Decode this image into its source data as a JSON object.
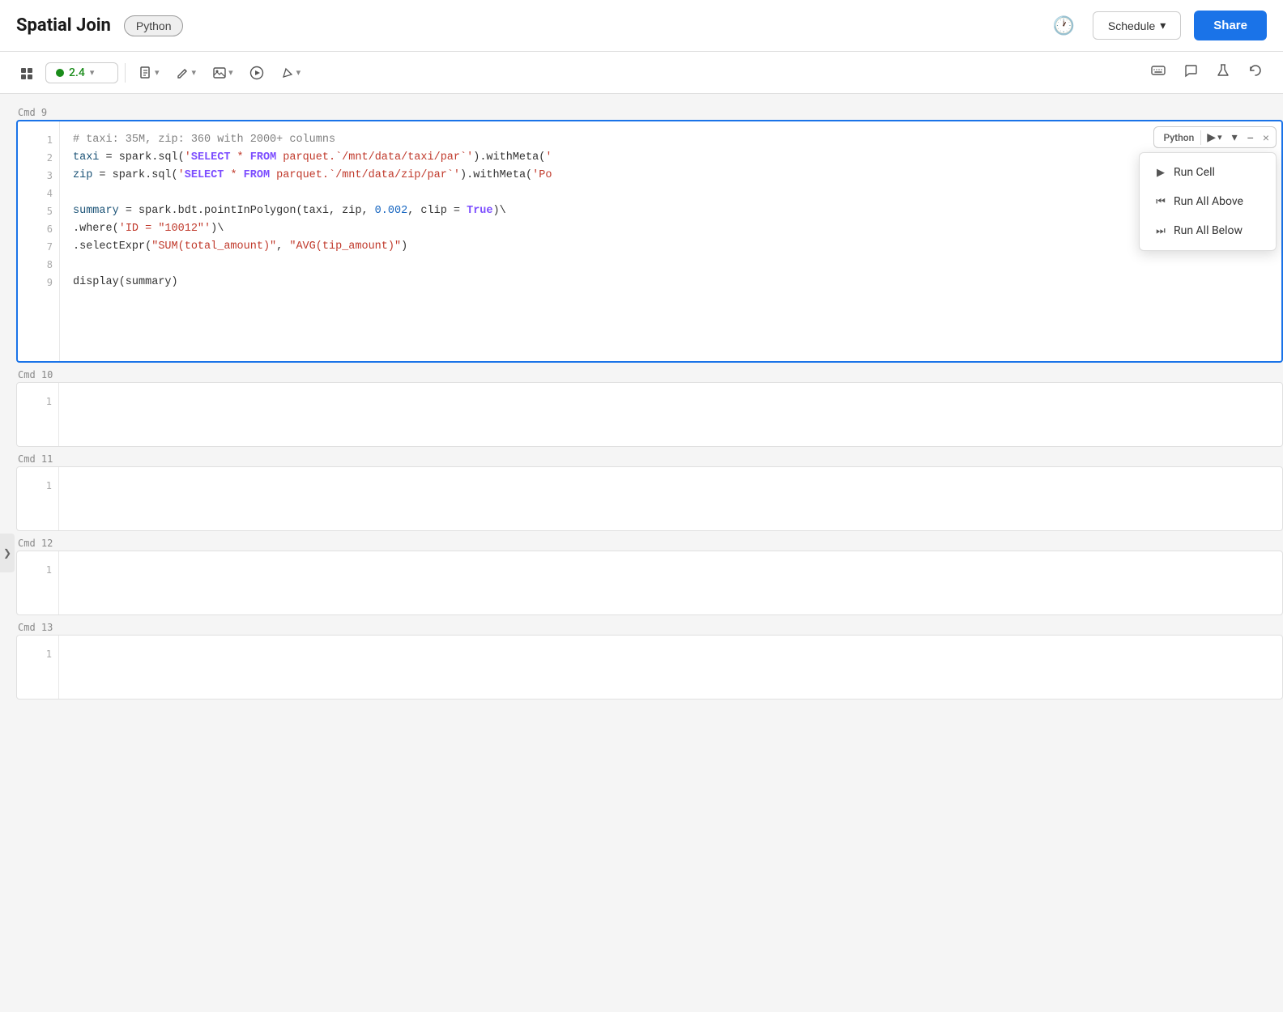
{
  "navbar": {
    "title": "Spatial Join",
    "lang_badge": "Python",
    "history_icon": "🕐",
    "schedule_label": "Schedule",
    "schedule_chevron": "▾",
    "share_label": "Share"
  },
  "toolbar": {
    "cluster_icon": "⊞",
    "status_value": "2.4",
    "status_color": "#1a8c1a",
    "doc_btn": "📄",
    "edit_btn": "✏️",
    "image_btn": "🖼",
    "run_btn": "▶",
    "pen_btn": "✒️",
    "keyboard_icon": "⌨",
    "comment_icon": "💬",
    "flask_icon": "⚗",
    "history_icon": "↺"
  },
  "active_cell": {
    "label": "Cmd 9",
    "lang": "Python",
    "run_label": "▶",
    "chevron_down": "▾",
    "collapse": "▾",
    "minus": "−",
    "close": "×",
    "lines": [
      {
        "num": 1,
        "parts": [
          {
            "type": "comment",
            "text": "# taxi: 35M, zip: 360 with 2000+ columns"
          }
        ]
      },
      {
        "num": 2,
        "parts": [
          {
            "type": "var",
            "text": "taxi"
          },
          {
            "type": "normal",
            "text": " = spark.sql("
          },
          {
            "type": "string",
            "text": "'"
          },
          {
            "type": "keyword",
            "text": "SELECT"
          },
          {
            "type": "string",
            "text": " * "
          },
          {
            "type": "keyword",
            "text": "FROM"
          },
          {
            "type": "string",
            "text": " parquet.`/mnt/data/taxi/par`'"
          },
          {
            "type": "normal",
            "text": ").withMeta("
          },
          {
            "type": "string-truncated",
            "text": "'"
          }
        ]
      },
      {
        "num": 3,
        "parts": [
          {
            "type": "var",
            "text": "zip"
          },
          {
            "type": "normal",
            "text": " = spark.sql("
          },
          {
            "type": "string",
            "text": "'"
          },
          {
            "type": "keyword",
            "text": "SELECT"
          },
          {
            "type": "string",
            "text": " * "
          },
          {
            "type": "keyword",
            "text": "FROM"
          },
          {
            "type": "string",
            "text": " parquet.`/mnt/data/zip/par`'"
          },
          {
            "type": "normal",
            "text": ").withMeta("
          },
          {
            "type": "truncated",
            "text": "'Po"
          }
        ]
      },
      {
        "num": 4,
        "parts": []
      },
      {
        "num": 5,
        "parts": [
          {
            "type": "var",
            "text": "summary"
          },
          {
            "type": "normal",
            "text": " = spark.bdt.pointInPolygon(taxi, zip, "
          },
          {
            "type": "number",
            "text": "0.002"
          },
          {
            "type": "normal",
            "text": ", clip = "
          },
          {
            "type": "keyword",
            "text": "True"
          },
          {
            "type": "normal",
            "text": ")\\"
          }
        ]
      },
      {
        "num": 6,
        "parts": [
          {
            "type": "normal",
            "text": ".where("
          },
          {
            "type": "string",
            "text": "'ID = \"10012\"'"
          },
          {
            "type": "normal",
            "text": ")\\"
          }
        ]
      },
      {
        "num": 7,
        "parts": [
          {
            "type": "normal",
            "text": ".selectExpr("
          },
          {
            "type": "string",
            "text": "\"SUM(total_amount)\""
          },
          {
            "type": "normal",
            "text": ", "
          },
          {
            "type": "string",
            "text": "\"AVG(tip_amount)\""
          },
          {
            "type": "normal",
            "text": ")"
          }
        ]
      },
      {
        "num": 8,
        "parts": []
      },
      {
        "num": 9,
        "parts": [
          {
            "type": "normal",
            "text": "display(summary)"
          }
        ]
      }
    ],
    "dropdown": {
      "items": [
        {
          "icon": "▶",
          "label": "Run Cell"
        },
        {
          "icon": "⏮",
          "label": "Run All Above"
        },
        {
          "icon": "⏭",
          "label": "Run All Below"
        }
      ]
    }
  },
  "empty_cells": [
    {
      "cmd": "Cmd 10",
      "line_num": "1"
    },
    {
      "cmd": "Cmd 11",
      "line_num": "1"
    },
    {
      "cmd": "Cmd 12",
      "line_num": "1"
    },
    {
      "cmd": "Cmd 13",
      "line_num": "1"
    }
  ],
  "sidebar_toggle": "❯"
}
